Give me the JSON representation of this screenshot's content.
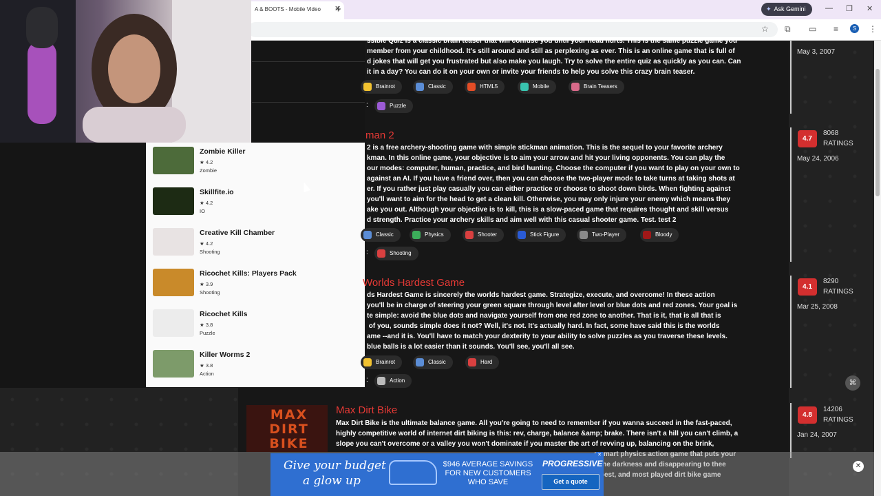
{
  "browser": {
    "tab_title": "A & BOOTS - Mobile Video",
    "tab_close": "✕",
    "new_tab": "+",
    "gemini_label": "Ask Gemini",
    "window_controls": [
      "—",
      "❐",
      "✕"
    ],
    "profile_initial": "S"
  },
  "sidebar": {
    "items": [
      {
        "name": "Zombie Killer",
        "rating": "4.2",
        "category": "Zombie",
        "thumb_color": "#4d6b3a"
      },
      {
        "name": "Skillfite.io",
        "rating": "4.2",
        "category": "IO",
        "thumb_color": "#1d2b14"
      },
      {
        "name": "Creative Kill Chamber",
        "rating": "4.2",
        "category": "Shooting",
        "thumb_color": "#e8e3e3"
      },
      {
        "name": "Ricochet Kills: Players Pack",
        "rating": "3.9",
        "category": "Shooting",
        "thumb_color": "#c98a2a"
      },
      {
        "name": "Ricochet Kills",
        "rating": "3.8",
        "category": "Puzzle",
        "thumb_color": "#ececec"
      },
      {
        "name": "Killer Worms 2",
        "rating": "3.8",
        "category": "Action",
        "thumb_color": "#7d9b6a"
      }
    ]
  },
  "games": [
    {
      "title": "",
      "desc_lines": [
        "ssible Quiz is a classic brain teaser that will confuse you until your head hurts. This is the same puzzle game you",
        "member from your childhood. It's still around and still as perplexing as ever. This is an online game that is full of",
        "d jokes that will get you frustrated but also make you laugh. Try to solve the entire quiz as quickly as you can. Can",
        "it in a day? You can do it on your own or invite your friends to help you solve this crazy brain teaser."
      ],
      "tags": [
        {
          "label": "Brainrot",
          "color": "#f2c230"
        },
        {
          "label": "Classic",
          "color": "#5b8dd6"
        },
        {
          "label": "HTML5",
          "color": "#e44d26"
        },
        {
          "label": "Mobile",
          "color": "#39c5b0"
        },
        {
          "label": "Brain Teasers",
          "color": "#d96a8a"
        }
      ],
      "tags2": [
        {
          "label": "Puzzle",
          "color": "#9c5bd6"
        }
      ],
      "rating": "",
      "rating_count": "",
      "ratings_label": "",
      "date": "May 3, 2007"
    },
    {
      "title": "man 2",
      "desc_lines": [
        "2 is a free archery-shooting game with simple stickman animation. This is the sequel to your favorite archery",
        "kman. In this online game, your objective is to aim your arrow and hit your living opponents. You can play the",
        "our modes: computer, human, practice, and bird hunting. Choose the computer if you want to play on your own to",
        "against an AI. If you have a friend over, then you can choose the two-player mode to take turns at taking shots at",
        "er. If you rather just play casually you can either practice or choose to shoot down birds. When fighting against",
        "you'll want to aim for the head to get a clean kill. Otherwise, you may only injure your enemy which means they",
        "ake you out. Although your objective is to kill, this is a slow-paced game that requires thought and skill versus",
        "d strength. Practice your archery skills and aim well with this casual shooter game. Test. test 2"
      ],
      "tags": [
        {
          "label": "Classic",
          "color": "#5b8dd6"
        },
        {
          "label": "Physics",
          "color": "#3cae5b"
        },
        {
          "label": "Shooter",
          "color": "#d94040"
        },
        {
          "label": "Stick Figure",
          "color": "#2a5bd6"
        },
        {
          "label": "Two-Player",
          "color": "#8a8a8a"
        },
        {
          "label": "Bloody",
          "color": "#a01818"
        }
      ],
      "tags2": [
        {
          "label": "Shooting",
          "color": "#d94040"
        }
      ],
      "rating": "4.7",
      "rating_count": "8068",
      "ratings_label": "RATINGS",
      "date": "May 24, 2006"
    },
    {
      "title": "Worlds Hardest Game",
      "desc_lines": [
        "ds Hardest Game is sincerely the worlds hardest game. Strategize, execute, and overcome! In these action",
        "you'll be in charge of steering your green square through level after level or blue dots and red zones. Your goal is",
        "te simple: avoid the blue dots and navigate yourself from one red zone to another. That is it, that is all that is",
        " of you, sounds simple does it not? Well, it's not. It's actually hard. In fact, some have said this is the worlds",
        "ame --and it is. You'll have to match your dexterity to your ability to solve puzzles as you traverse these levels.",
        "blue balls is a lot easier than it sounds. You'll see, you'll all see."
      ],
      "tags": [
        {
          "label": "Brainrot",
          "color": "#f2c230"
        },
        {
          "label": "Classic",
          "color": "#5b8dd6"
        },
        {
          "label": "Hard",
          "color": "#d94040"
        }
      ],
      "tags2": [
        {
          "label": "Action",
          "color": "#bbbbbb"
        }
      ],
      "rating": "4.1",
      "rating_count": "8290",
      "ratings_label": "RATINGS",
      "date": "Mar 25, 2008"
    },
    {
      "title": "Max Dirt Bike",
      "thumb_text": "MAX DIRT BIKE",
      "desc_lines": [
        "Max Dirt Bike is the ultimate balance game. All you're going to need to remember if you wanna succeed in the fast-paced,",
        "highly competitive world of internet dirt biking is this: rev, charge, balance &amp; brake. There isn't a hill you can't climb, a",
        "slope you can't overcome or a valley you won't dominate if you master the art of revving up, balancing on the brink,",
        "a smart physics action game that puts your",
        "o the darkness and disappearing to thee",
        "t, best, and most played dirt bike game"
      ],
      "rating": "4.8",
      "rating_count": "14206",
      "ratings_label": "RATINGS",
      "date": "Jan 24, 2007"
    }
  ],
  "ad": {
    "line1": "Give your budget",
    "line2": "a glow up",
    "offer": "$946 AVERAGE SAVINGS FOR NEW CUSTOMERS WHO SAVE",
    "brand": "PROGRESSIVE",
    "cta": "Get a quote",
    "close": "✕"
  },
  "icons": {
    "star": "★",
    "colon": ":",
    "pdf": "⌘"
  }
}
